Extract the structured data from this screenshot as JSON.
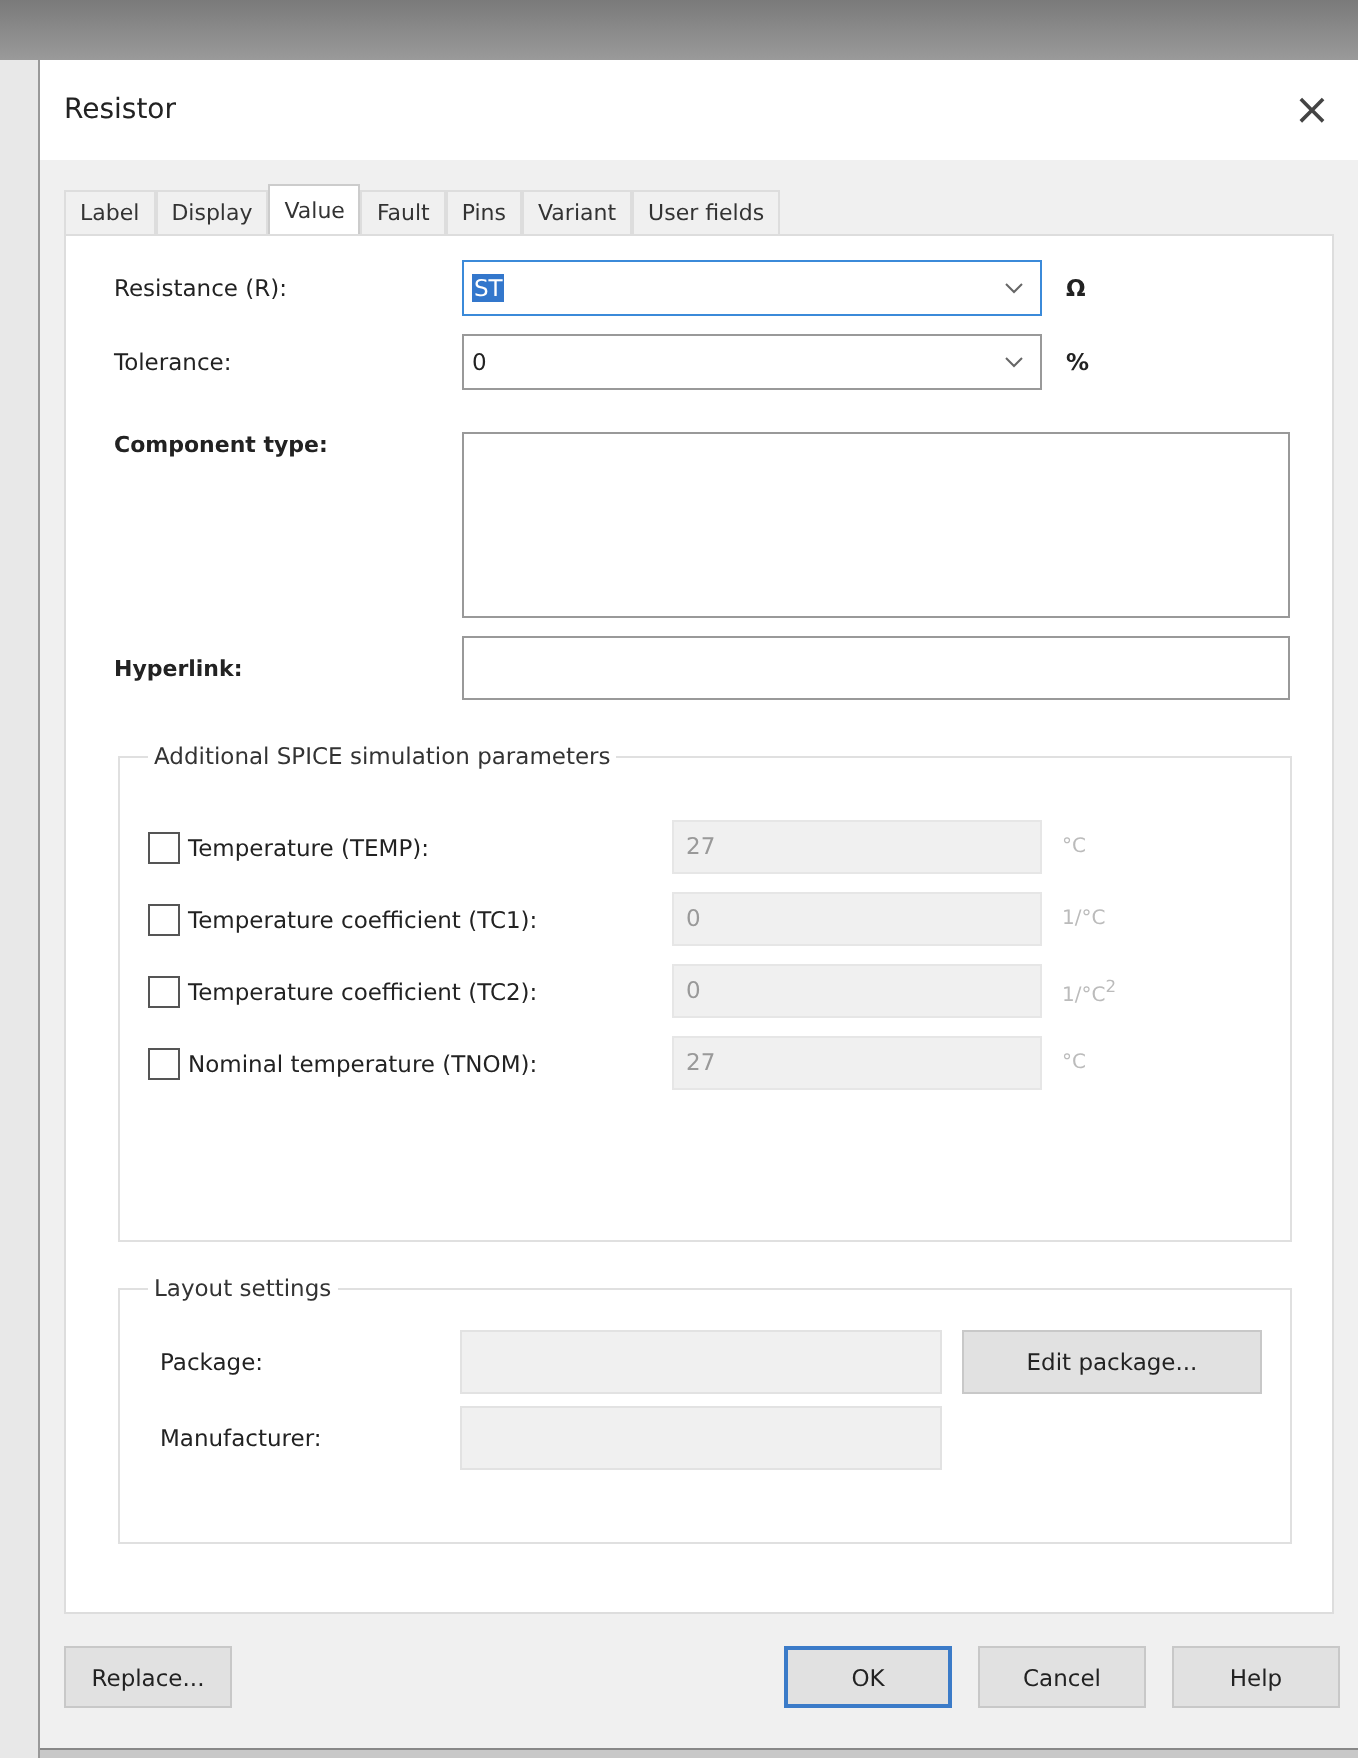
{
  "window": {
    "title": "Resistor",
    "close": "×"
  },
  "tabs": [
    {
      "label": "Label",
      "selected": false
    },
    {
      "label": "Display",
      "selected": false
    },
    {
      "label": "Value",
      "selected": true
    },
    {
      "label": "Fault",
      "selected": false
    },
    {
      "label": "Pins",
      "selected": false
    },
    {
      "label": "Variant",
      "selected": false
    },
    {
      "label": "User fields",
      "selected": false
    }
  ],
  "value_fields": [
    {
      "label": "Resistance (R):",
      "value": "ST",
      "unit": "Ω",
      "focused": true
    },
    {
      "label": "Tolerance:",
      "value": "0",
      "unit": "%",
      "focused": false
    }
  ],
  "component_type": {
    "label": "Component type:"
  },
  "hyperlink": {
    "label": "Hyperlink:"
  },
  "spice": {
    "title": "Additional SPICE simulation parameters",
    "params": [
      {
        "label": "Temperature (TEMP):",
        "checked": false,
        "value": "27",
        "unit": "°C"
      },
      {
        "label": "Temperature coefficient (TC1):",
        "checked": false,
        "value": "0",
        "unit": "1/°C"
      },
      {
        "label": "Temperature coefficient (TC2):",
        "checked": false,
        "value": "0",
        "unit": "1/°C$^{2}$"
      },
      {
        "label": "Nominal temperature (TNOM):",
        "checked": false,
        "value": "27",
        "unit": "°C"
      }
    ]
  },
  "layout": {
    "title": "Layout settings",
    "package_label": "Package:",
    "manufacturer_label": "Manufacturer:",
    "edit_button": "Edit package..."
  },
  "buttons": {
    "replace": "Replace...",
    "ok": "OK",
    "cancel": "Cancel",
    "help": "Help"
  }
}
